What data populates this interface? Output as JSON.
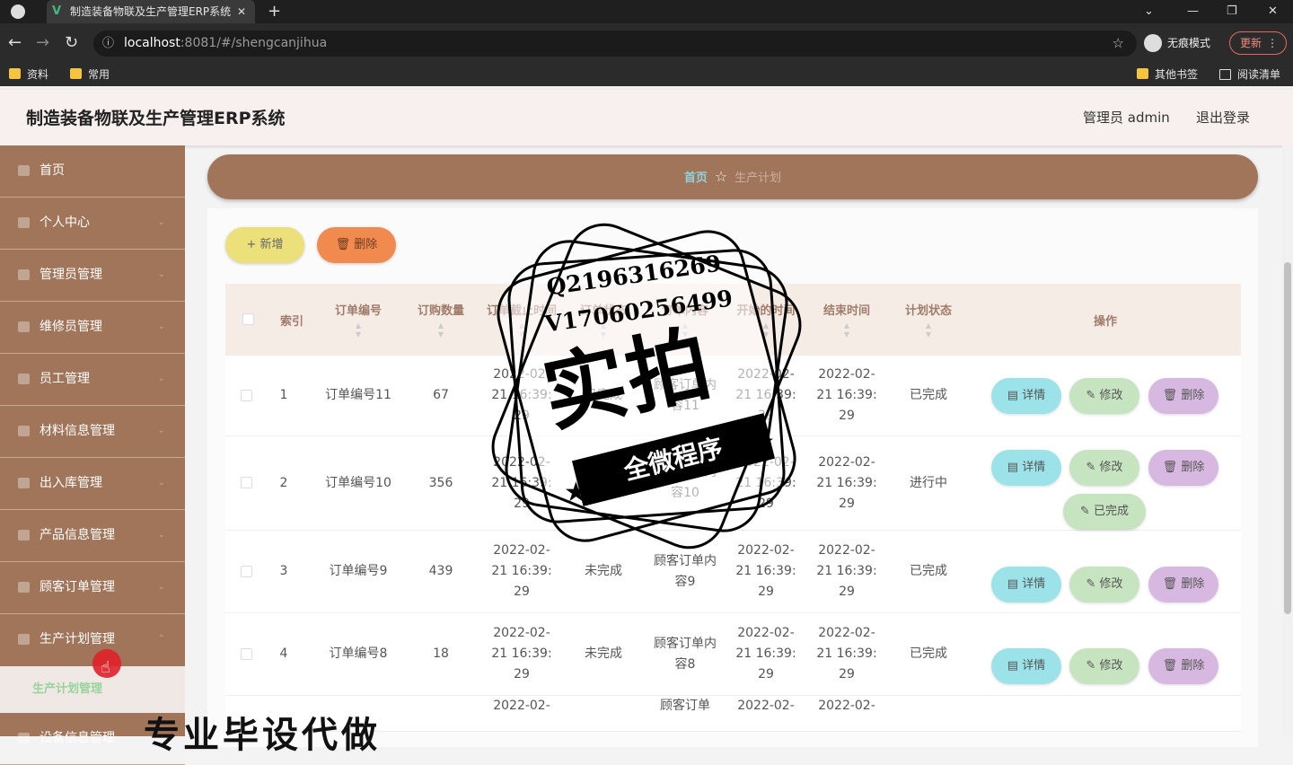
{
  "browser": {
    "tab_title": "制造装备物联及生产管理ERP系统",
    "tab_close": "✕",
    "new_tab": "+",
    "url_host": "localhost",
    "url_rest": ":8081/#/shengcanjihua",
    "incognito_label": "无痕模式",
    "update_label": "更新",
    "bookmarks": [
      "资料",
      "常用"
    ],
    "bookmarks_right": [
      "其他书签",
      "阅读清单"
    ]
  },
  "header": {
    "title": "制造装备物联及生产管理ERP系统",
    "user": "管理员 admin",
    "logout": "退出登录"
  },
  "sidebar": {
    "items": [
      {
        "label": "首页",
        "expandable": false
      },
      {
        "label": "个人中心",
        "expandable": true
      },
      {
        "label": "管理员管理",
        "expandable": true
      },
      {
        "label": "维修员管理",
        "expandable": true
      },
      {
        "label": "员工管理",
        "expandable": true
      },
      {
        "label": "材料信息管理",
        "expandable": true
      },
      {
        "label": "出入库管理",
        "expandable": true
      },
      {
        "label": "产品信息管理",
        "expandable": true
      },
      {
        "label": "顾客订单管理",
        "expandable": true
      },
      {
        "label": "生产计划管理",
        "expandable": true
      }
    ],
    "submenu": "生产计划管理",
    "next_item": "设备信息管理"
  },
  "breadcrumb": {
    "home": "首页",
    "current": "生产计划"
  },
  "toolbar": {
    "add_label": "+ 新增",
    "delete_label": "🗑 删除"
  },
  "table": {
    "headers": {
      "index": "索引",
      "order_no": "订单编号",
      "quantity": "订购数量",
      "deadline": "订单截止时间",
      "order_status": "订单状态",
      "order_content": "订单内容",
      "start_time": "开始的时间",
      "end_time": "结束时间",
      "plan_status": "计划状态",
      "actions": "操作"
    },
    "rows": [
      {
        "index": "1",
        "order_no": "订单编号11",
        "quantity": "67",
        "deadline": "2022-02-21 16:39:29",
        "order_status": "已完成",
        "order_content": "顾客订单内容11",
        "start_time": "2022-02-21 16:39:29",
        "end_time": "2022-02-21 16:39:29",
        "plan_status": "已完成"
      },
      {
        "index": "2",
        "order_no": "订单编号10",
        "quantity": "356",
        "deadline": "2022-02-21 16:39:29",
        "order_status": "已完成",
        "order_content": "顾客订单内容10",
        "start_time": "2022-02-21 16:39:29",
        "end_time": "2022-02-21 16:39:29",
        "plan_status": "进行中"
      },
      {
        "index": "3",
        "order_no": "订单编号9",
        "quantity": "439",
        "deadline": "2022-02-21 16:39:29",
        "order_status": "未完成",
        "order_content": "顾客订单内容9",
        "start_time": "2022-02-21 16:39:29",
        "end_time": "2022-02-21 16:39:29",
        "plan_status": "已完成"
      },
      {
        "index": "4",
        "order_no": "订单编号8",
        "quantity": "18",
        "deadline": "2022-02-21 16:39:29",
        "order_status": "未完成",
        "order_content": "顾客订单内容8",
        "start_time": "2022-02-21 16:39:29",
        "end_time": "2022-02-21 16:39:29",
        "plan_status": "已完成"
      },
      {
        "index": "",
        "order_no": "",
        "quantity": "",
        "deadline": "2022-02-",
        "order_status": "",
        "order_content": "顾客订单",
        "start_time": "2022-02-",
        "end_time": "2022-02-",
        "plan_status": ""
      }
    ],
    "op_detail": "详情",
    "op_edit": "修改",
    "op_delete": "删除",
    "op_done": "已完成"
  },
  "watermark": {
    "line1": "Q2196316269",
    "line2": "V17060256499",
    "big": "实拍",
    "ribbon": "全微程序",
    "bottom": "专业毕设代做"
  }
}
